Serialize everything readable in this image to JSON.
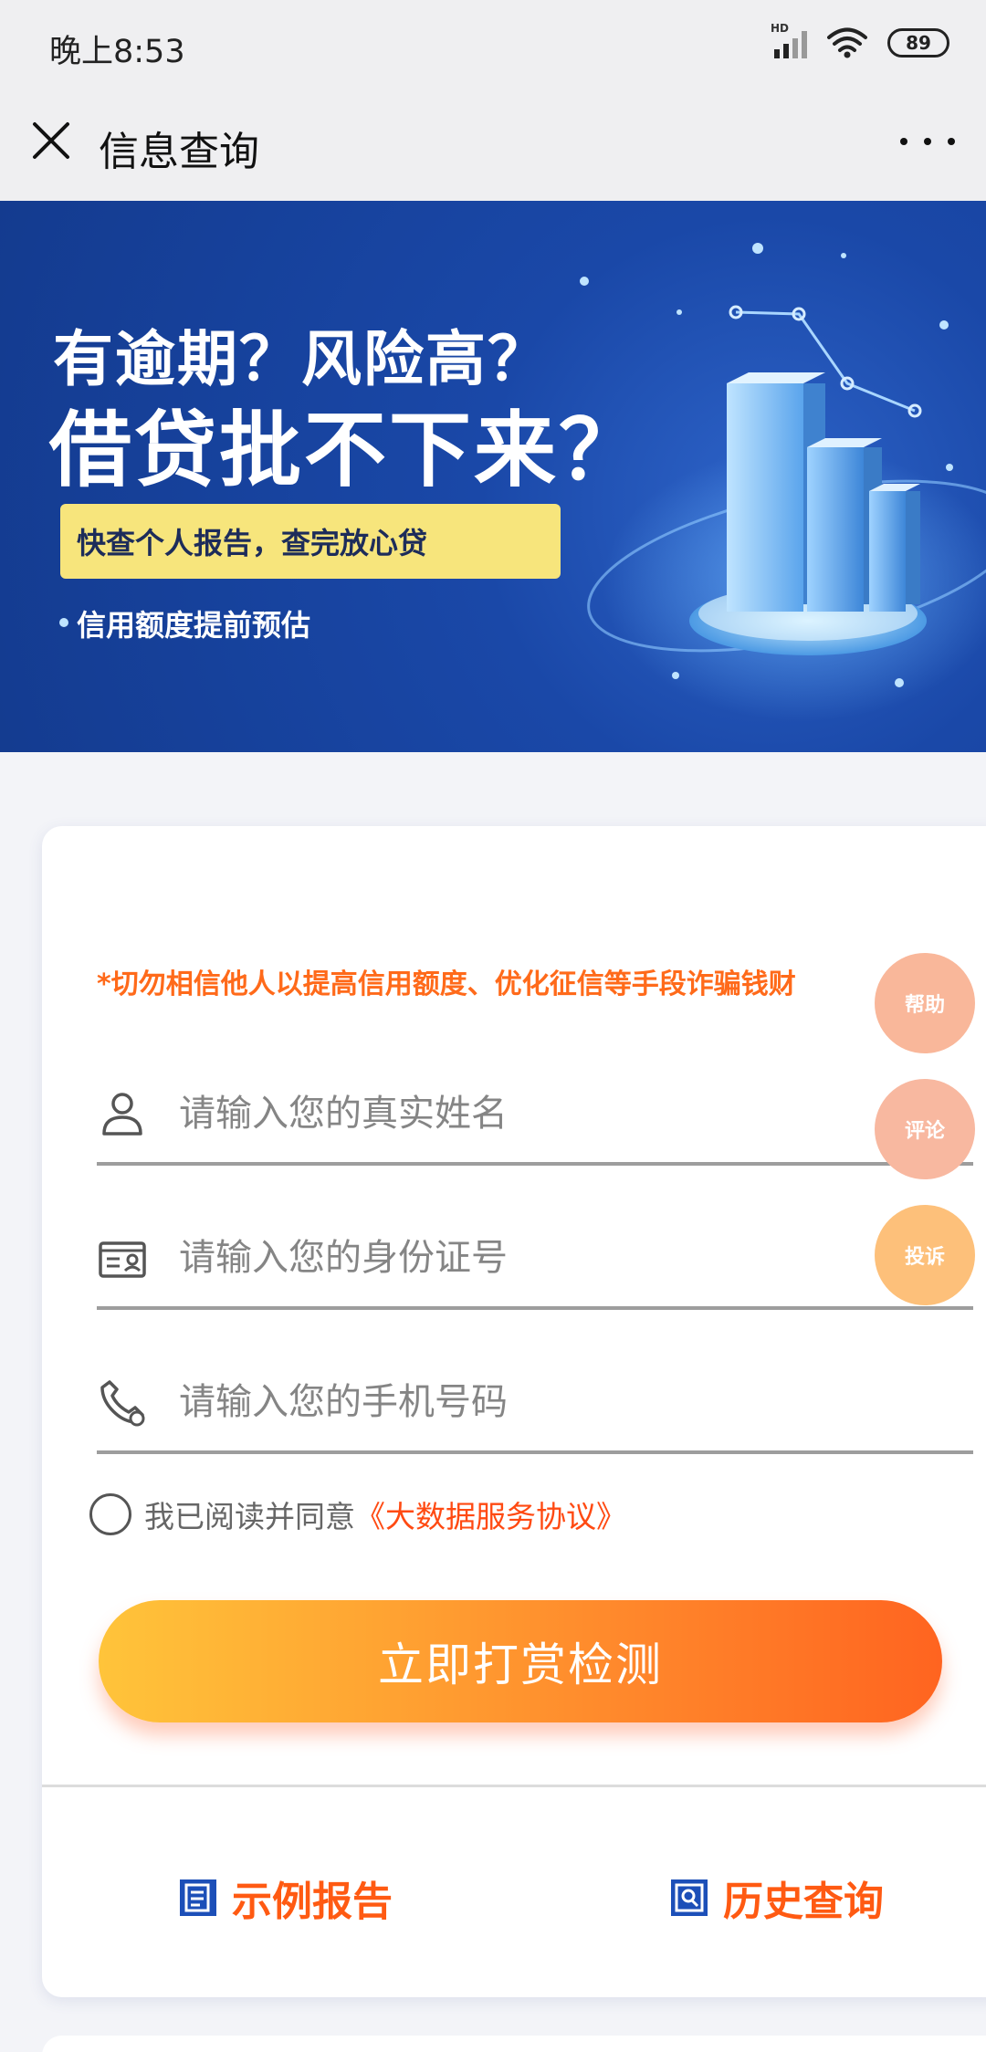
{
  "status_bar": {
    "time": "晚上8:53",
    "network": "HD",
    "battery": "89"
  },
  "title_bar": {
    "title": "信息查询"
  },
  "banner": {
    "line1": "有逾期？风险高？",
    "line2": "借贷批不下来？",
    "tag": "快查个人报告，查完放心贷",
    "sub": "信用额度提前预估",
    "colors": {
      "background": "#16419b",
      "tag": "#f7e57c"
    }
  },
  "form": {
    "warning": "*切勿相信他人以提高信用额度、优化征信等手段诈骗钱财",
    "name_placeholder": "请输入您的真实姓名",
    "id_placeholder": "请输入您的身份证号",
    "phone_placeholder": "请输入您的手机号码",
    "agree_text": "我已阅读并同意",
    "agree_link": "《大数据服务协议》",
    "submit_label": "立即打赏检测"
  },
  "links": {
    "sample_report": "示例报告",
    "history": "历史查询"
  },
  "floating": {
    "help": "帮助",
    "comment": "评论",
    "complaint": "投诉"
  },
  "colors": {
    "accent": "#ff5a12",
    "button_start": "#ffc43a",
    "button_end": "#ff6420",
    "icon_blue": "#1c4fb8"
  }
}
